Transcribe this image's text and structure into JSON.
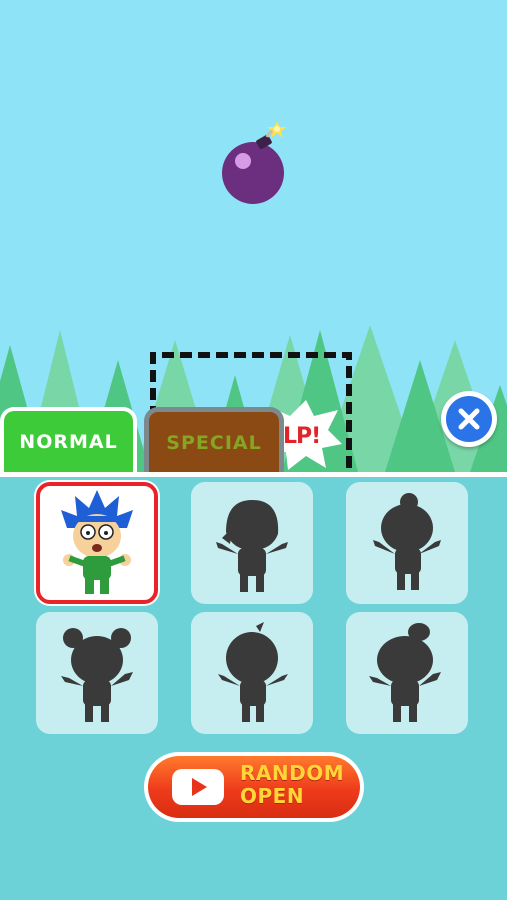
{
  "scene": {
    "help_text": "LP!",
    "colors": {
      "sky": "#8fe3f7",
      "tree": "#4fc684",
      "bomb": "#6c2f80"
    }
  },
  "tabs": [
    {
      "label": "NORMAL",
      "active": true,
      "color": "#3dcb3a"
    },
    {
      "label": "SPECIAL",
      "active": false,
      "color": "#8b4a14"
    }
  ],
  "close_button": {
    "icon": "close-icon"
  },
  "characters": [
    {
      "id": "boy-blue-hair",
      "unlocked": true,
      "selected": true
    },
    {
      "id": "girl-bob",
      "unlocked": false,
      "selected": false
    },
    {
      "id": "girl-bun",
      "unlocked": false,
      "selected": false
    },
    {
      "id": "bear-ears",
      "unlocked": false,
      "selected": false
    },
    {
      "id": "boy-cowlick",
      "unlocked": false,
      "selected": false
    },
    {
      "id": "girl-topknot",
      "unlocked": false,
      "selected": false
    }
  ],
  "random_open": {
    "line1": "RANDOM",
    "line2": "OPEN",
    "icon": "play-video-icon"
  }
}
